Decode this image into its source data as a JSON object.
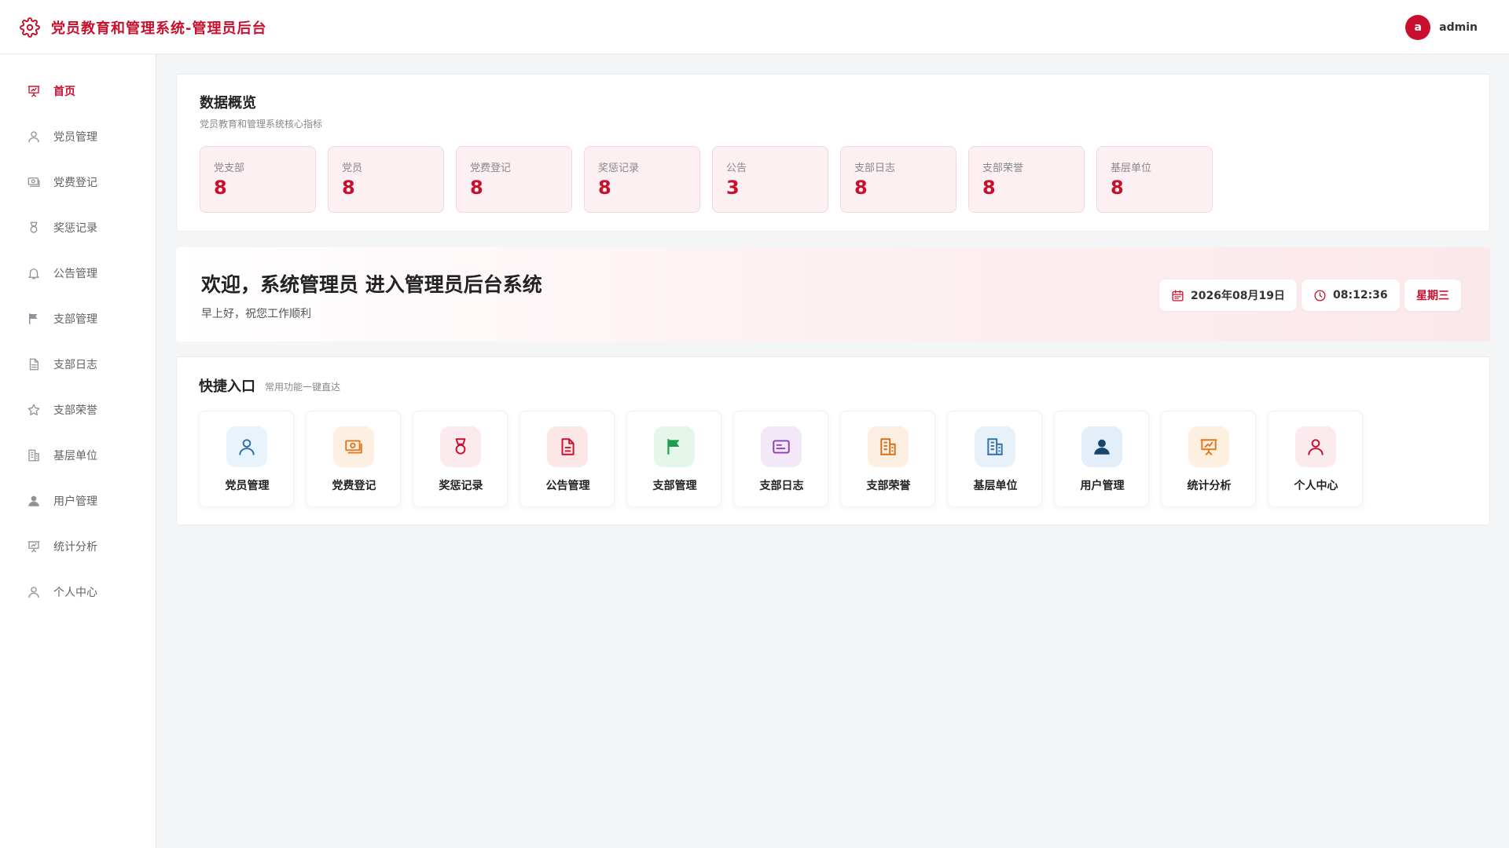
{
  "header": {
    "title": "党员教育和管理系统-管理员后台",
    "brand_icon": "gear-icon",
    "avatar_letter": "a",
    "username": "admin",
    "accent": "#c8102e"
  },
  "sidebar": {
    "active": "首页",
    "items": [
      {
        "label": "首页",
        "icon": "presentation-chart-icon"
      },
      {
        "label": "党员管理",
        "icon": "user-icon"
      },
      {
        "label": "党费登记",
        "icon": "money-icon"
      },
      {
        "label": "奖惩记录",
        "icon": "medal-icon"
      },
      {
        "label": "公告管理",
        "icon": "bell-icon"
      },
      {
        "label": "支部管理",
        "icon": "flag-icon"
      },
      {
        "label": "支部日志",
        "icon": "document-icon"
      },
      {
        "label": "支部荣誉",
        "icon": "star-icon"
      },
      {
        "label": "基层单位",
        "icon": "building-icon"
      },
      {
        "label": "用户管理",
        "icon": "user-filled-icon"
      },
      {
        "label": "统计分析",
        "icon": "presentation-chart-icon"
      },
      {
        "label": "个人中心",
        "icon": "user-icon"
      }
    ]
  },
  "overview": {
    "title": "数据概览",
    "subtitle": "党员教育和管理系统核心指标",
    "stats": [
      {
        "label": "党支部",
        "value": "8"
      },
      {
        "label": "党员",
        "value": "8"
      },
      {
        "label": "党费登记",
        "value": "8"
      },
      {
        "label": "奖惩记录",
        "value": "8"
      },
      {
        "label": "公告",
        "value": "3"
      },
      {
        "label": "支部日志",
        "value": "8"
      },
      {
        "label": "支部荣誉",
        "value": "8"
      },
      {
        "label": "基层单位",
        "value": "8"
      }
    ]
  },
  "welcome": {
    "title": "欢迎，系统管理员 进入管理员后台系统",
    "subtitle": "早上好，祝您工作顺利",
    "date": "2026年08月19日",
    "time": "08:12:36",
    "weekday": "星期三"
  },
  "quick": {
    "title": "快捷入口",
    "subtitle": "常用功能一键直达",
    "items": [
      {
        "label": "党员管理",
        "icon": "user-icon",
        "color": "#2f6fa6",
        "bg": "#e9f3fb"
      },
      {
        "label": "党费登记",
        "icon": "money-icon",
        "color": "#e07a1f",
        "bg": "#fdf0e2"
      },
      {
        "label": "奖惩记录",
        "icon": "medal-icon",
        "color": "#c8102e",
        "bg": "#fcebee"
      },
      {
        "label": "公告管理",
        "icon": "document-icon",
        "color": "#c8102e",
        "bg": "#fce6e6"
      },
      {
        "label": "支部管理",
        "icon": "flag-icon",
        "color": "#1e9e4a",
        "bg": "#e5f6ea"
      },
      {
        "label": "支部日志",
        "icon": "card-icon",
        "color": "#8e3fb0",
        "bg": "#f3e8f8"
      },
      {
        "label": "支部荣誉",
        "icon": "building-icon",
        "color": "#d3701e",
        "bg": "#fdeee2"
      },
      {
        "label": "基层单位",
        "icon": "building-icon",
        "color": "#2f6fa6",
        "bg": "#e7f1fa"
      },
      {
        "label": "用户管理",
        "icon": "user-filled-icon",
        "color": "#16466e",
        "bg": "#e3eef8"
      },
      {
        "label": "统计分析",
        "icon": "presentation-chart-icon",
        "color": "#e07a1f",
        "bg": "#fdf0e0"
      },
      {
        "label": "个人中心",
        "icon": "user-icon",
        "color": "#c8102e",
        "bg": "#fcebee"
      }
    ]
  }
}
